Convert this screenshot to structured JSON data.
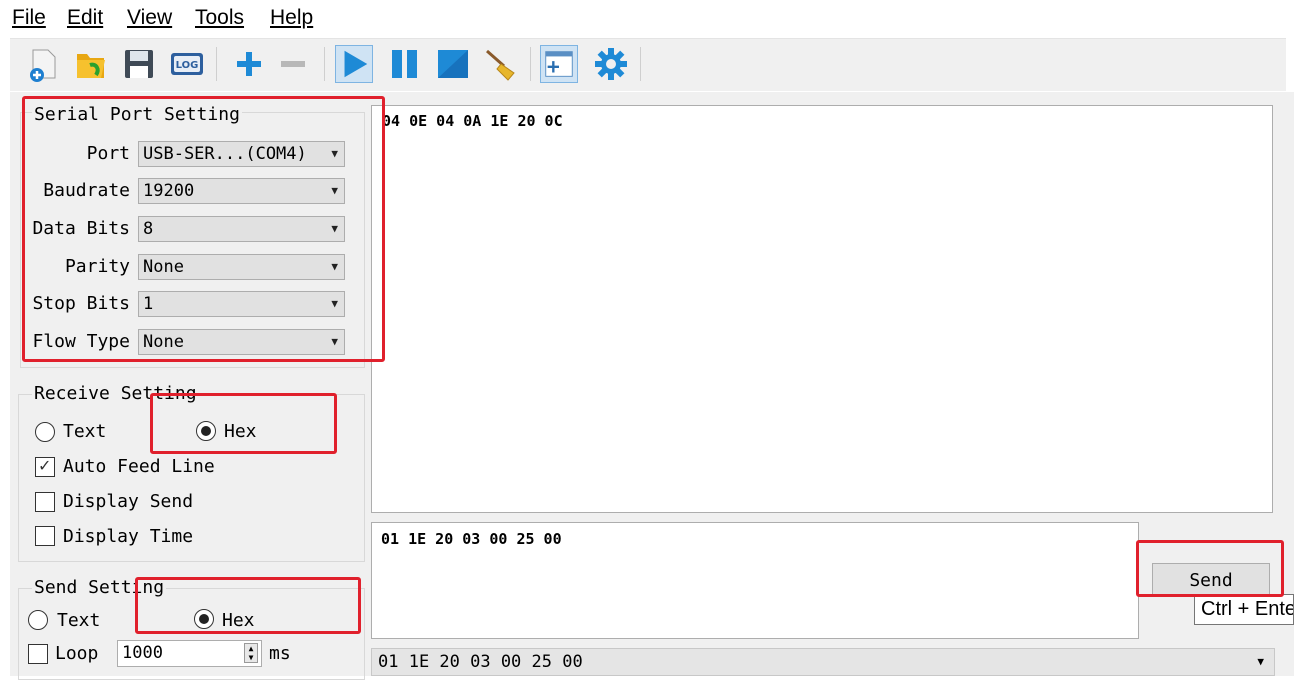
{
  "menu": {
    "file": "File",
    "edit": "Edit",
    "view": "View",
    "tools": "Tools",
    "help": "Help"
  },
  "toolbar": {
    "log_label": "LOG",
    "icons": [
      "new-file-icon",
      "open-folder-icon",
      "save-icon",
      "log-icon",
      "add-icon",
      "remove-icon",
      "play-icon",
      "pause-icon",
      "stop-icon",
      "clear-broom-icon",
      "new-window-icon",
      "settings-gear-icon"
    ]
  },
  "serial_port": {
    "title": "Serial Port Setting",
    "port_label": "Port",
    "port_value": "USB-SER...(COM4)",
    "baudrate_label": "Baudrate",
    "baudrate_value": "19200",
    "databits_label": "Data Bits",
    "databits_value": "8",
    "parity_label": "Parity",
    "parity_value": "None",
    "stopbits_label": "Stop Bits",
    "stopbits_value": "1",
    "flow_label": "Flow Type",
    "flow_value": "None"
  },
  "receive": {
    "title": "Receive Setting",
    "text_label": "Text",
    "hex_label": "Hex",
    "mode": "Hex",
    "auto_feed_label": "Auto Feed Line",
    "auto_feed_checked": true,
    "display_send_label": "Display Send",
    "display_send_checked": false,
    "display_time_label": "Display Time",
    "display_time_checked": false,
    "data": "04 0E 04 0A 1E 20 0C"
  },
  "send": {
    "title": "Send Setting",
    "text_label": "Text",
    "hex_label": "Hex",
    "mode": "Hex",
    "loop_label": "Loop",
    "loop_checked": false,
    "loop_value": "1000",
    "loop_unit": "ms",
    "data": "01 1E 20 03 00 25 00",
    "button_label": "Send",
    "tooltip": "Ctrl + Enter",
    "history_value": "01 1E 20 03 00 25 00"
  },
  "colors": {
    "highlight": "#e0202c",
    "accent_blue": "#1e8ad6"
  }
}
